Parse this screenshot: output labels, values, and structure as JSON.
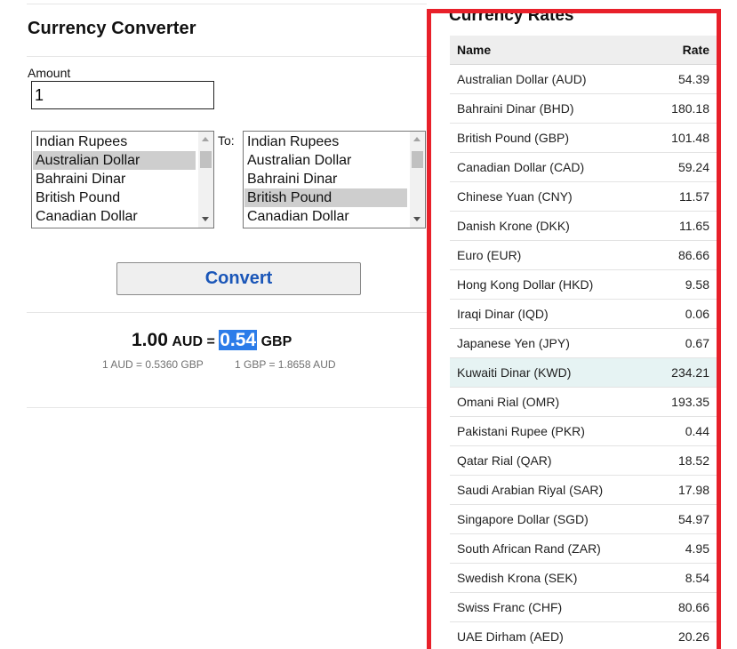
{
  "converter": {
    "title": "Currency Converter",
    "amount_label": "Amount",
    "amount_value": "1",
    "to_label": "To:",
    "from_options": [
      "Indian Rupees",
      "Australian Dollar",
      "Bahraini Dinar",
      "British Pound",
      "Canadian Dollar"
    ],
    "from_selected": "Australian Dollar",
    "to_options": [
      "Indian Rupees",
      "Australian Dollar",
      "Bahraini Dinar",
      "British Pound",
      "Canadian Dollar"
    ],
    "to_selected": "British Pound",
    "convert_label": "Convert",
    "result": {
      "amount": "1.00",
      "from_code": "AUD =",
      "value": "0.54",
      "to_code": "GBP",
      "note_from": "1 AUD = 0.5360 GBP",
      "note_to": "1 GBP = 1.8658 AUD"
    }
  },
  "rates": {
    "title": "Currency Rates",
    "col_name": "Name",
    "col_rate": "Rate",
    "highlight_color": "#e6f3f3",
    "rows": [
      {
        "name": "Australian Dollar (AUD)",
        "rate": "54.39"
      },
      {
        "name": "Bahraini Dinar (BHD)",
        "rate": "180.18"
      },
      {
        "name": "British Pound (GBP)",
        "rate": "101.48"
      },
      {
        "name": "Canadian Dollar (CAD)",
        "rate": "59.24"
      },
      {
        "name": "Chinese Yuan (CNY)",
        "rate": "11.57"
      },
      {
        "name": "Danish Krone (DKK)",
        "rate": "11.65"
      },
      {
        "name": "Euro (EUR)",
        "rate": "86.66"
      },
      {
        "name": "Hong Kong Dollar (HKD)",
        "rate": "9.58"
      },
      {
        "name": "Iraqi Dinar (IQD)",
        "rate": "0.06"
      },
      {
        "name": "Japanese Yen (JPY)",
        "rate": "0.67"
      },
      {
        "name": "Kuwaiti Dinar (KWD)",
        "rate": "234.21",
        "highlighted": true
      },
      {
        "name": "Omani Rial (OMR)",
        "rate": "193.35"
      },
      {
        "name": "Pakistani Rupee (PKR)",
        "rate": "0.44"
      },
      {
        "name": "Qatar Rial (QAR)",
        "rate": "18.52"
      },
      {
        "name": "Saudi Arabian Riyal (SAR)",
        "rate": "17.98"
      },
      {
        "name": "Singapore Dollar (SGD)",
        "rate": "54.97"
      },
      {
        "name": "South African Rand (ZAR)",
        "rate": "4.95"
      },
      {
        "name": "Swedish Krona (SEK)",
        "rate": "8.54"
      },
      {
        "name": "Swiss Franc (CHF)",
        "rate": "80.66"
      },
      {
        "name": "UAE Dirham (AED)",
        "rate": "20.26"
      }
    ]
  },
  "colors": {
    "accent_border": "#e8202a",
    "button_text": "#1a56b8",
    "result_highlight": "#2b7ce9"
  }
}
